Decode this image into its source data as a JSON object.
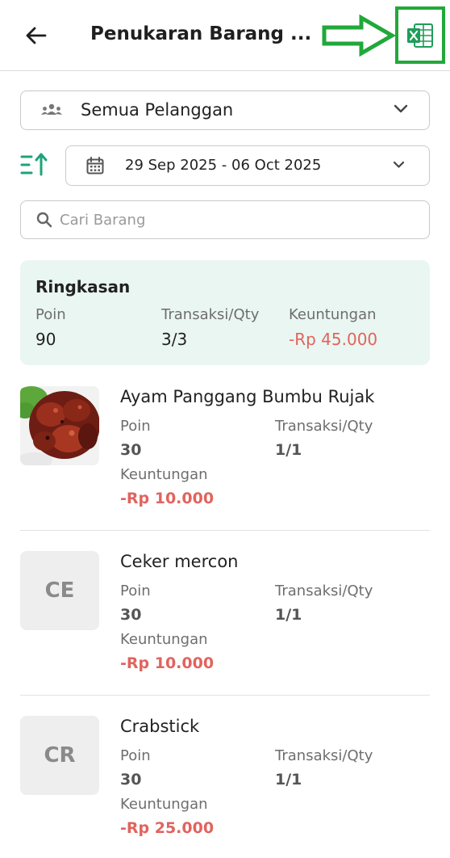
{
  "header": {
    "title": "Penukaran Barang ...",
    "back_icon": "arrow-left-icon",
    "export_icon": "excel-icon",
    "annotation_color": "#22a83a"
  },
  "filters": {
    "customer": "Semua Pelanggan",
    "date_range": "29 Sep 2025 - 06 Oct 2025",
    "search_placeholder": "Cari Barang",
    "search_value": ""
  },
  "summary": {
    "title": "Ringkasan",
    "poin_label": "Poin",
    "poin_value": "90",
    "trx_label": "Transaksi/Qty",
    "trx_value": "3/3",
    "profit_label": "Keuntungan",
    "profit_value": "-Rp 45.000"
  },
  "items": [
    {
      "name": "Ayam Panggang Bumbu Rujak",
      "has_image": true,
      "initials": "",
      "poin_label": "Poin",
      "poin": "30",
      "trx_label": "Transaksi/Qty",
      "trx": "1/1",
      "profit_label": "Keuntungan",
      "profit": "-Rp 10.000"
    },
    {
      "name": "Ceker mercon",
      "has_image": false,
      "initials": "CE",
      "poin_label": "Poin",
      "poin": "30",
      "trx_label": "Transaksi/Qty",
      "trx": "1/1",
      "profit_label": "Keuntungan",
      "profit": "-Rp 10.000"
    },
    {
      "name": "Crabstick",
      "has_image": false,
      "initials": "CR",
      "poin_label": "Poin",
      "poin": "30",
      "trx_label": "Transaksi/Qty",
      "trx": "1/1",
      "profit_label": "Keuntungan",
      "profit": "-Rp 25.000"
    }
  ],
  "colors": {
    "accent": "#1fa37a",
    "negative": "#e0645e",
    "summary_bg": "#eaf6f1"
  }
}
